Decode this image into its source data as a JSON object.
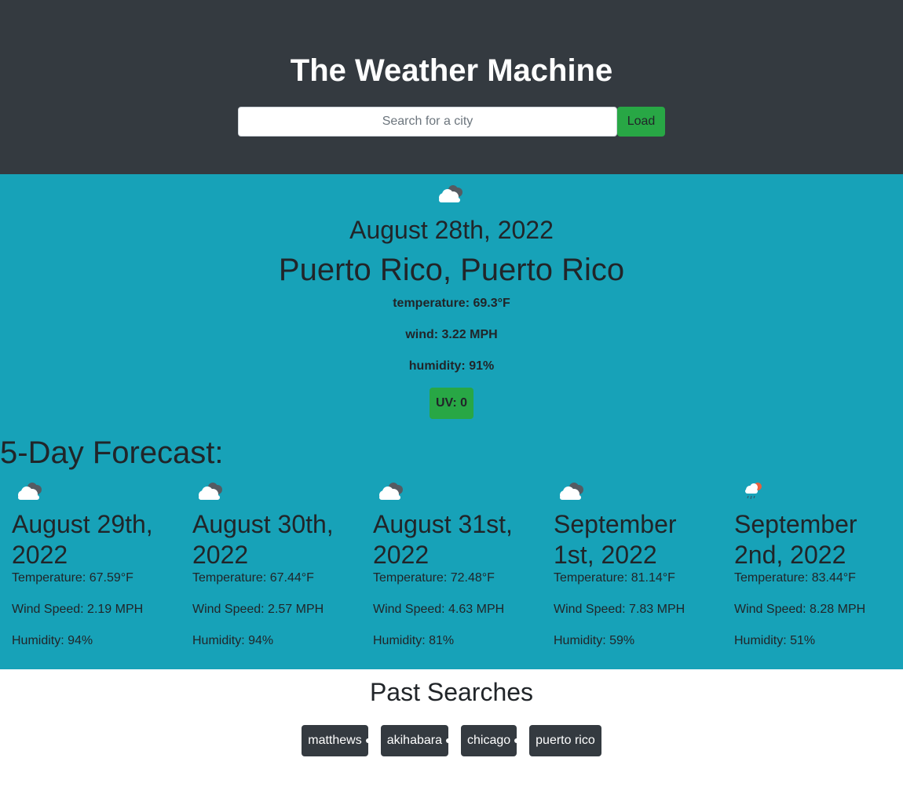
{
  "header": {
    "title": "The Weather Machine",
    "search_placeholder": "Search for a city",
    "load_label": "Load"
  },
  "current": {
    "icon": "cloudy-icon",
    "date": "August 28th, 2022",
    "city": "Puerto Rico, Puerto Rico",
    "temperature": "temperature: 69.3°F",
    "wind": "wind: 3.22 MPH",
    "humidity": "humidity: 91%",
    "uv": "UV: 0",
    "uv_color": "#28a745"
  },
  "forecast": {
    "heading": "5-Day Forecast:",
    "days": [
      {
        "icon": "cloudy-icon",
        "date": "August 29th, 2022",
        "temp": "Temperature: 67.59°F",
        "wind": "Wind Speed: 2.19 MPH",
        "humidity": "Humidity: 94%"
      },
      {
        "icon": "cloudy-icon",
        "date": "August 30th, 2022",
        "temp": "Temperature: 67.44°F",
        "wind": "Wind Speed: 2.57 MPH",
        "humidity": "Humidity: 94%"
      },
      {
        "icon": "cloudy-icon",
        "date": "August 31st, 2022",
        "temp": "Temperature: 72.48°F",
        "wind": "Wind Speed: 4.63 MPH",
        "humidity": "Humidity: 81%"
      },
      {
        "icon": "cloudy-icon",
        "date": "September 1st, 2022",
        "temp": "Temperature: 81.14°F",
        "wind": "Wind Speed: 7.83 MPH",
        "humidity": "Humidity: 59%"
      },
      {
        "icon": "sun-rain-icon",
        "date": "September 2nd, 2022",
        "temp": "Temperature: 83.44°F",
        "wind": "Wind Speed: 8.28 MPH",
        "humidity": "Humidity: 51%"
      }
    ]
  },
  "past_searches": {
    "title": "Past Searches",
    "items": [
      "matthews",
      "akihabara",
      "chicago",
      "puerto rico"
    ]
  },
  "colors": {
    "header_bg": "#343a40",
    "main_bg": "#17a2b8",
    "accent_green": "#28a745"
  }
}
